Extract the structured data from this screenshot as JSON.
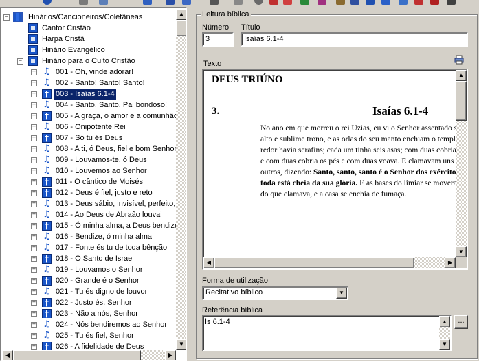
{
  "tree": {
    "root_label": "Hinários/Cancioneiros/Coletâneas",
    "books": [
      {
        "label": "Cantor Cristão"
      },
      {
        "label": "Harpa Cristã"
      },
      {
        "label": "Hinário Evangélico"
      },
      {
        "label": "Hinário para o Culto Cristão"
      }
    ],
    "items": [
      {
        "label": "001 - Oh, vinde adorar!",
        "icon": "music-note-icon",
        "selected": false
      },
      {
        "label": "002 - Santo! Santo! Santo!",
        "icon": "music-note-icon",
        "selected": false
      },
      {
        "label": "003 - Isaías 6.1-4",
        "icon": "bible-reading-icon",
        "selected": true
      },
      {
        "label": "004 - Santo, Santo, Pai bondoso!",
        "icon": "music-note-icon",
        "selected": false
      },
      {
        "label": "005 - A graça, o amor e a comunhão",
        "icon": "bible-reading-icon",
        "selected": false
      },
      {
        "label": "006 - Onipotente Rei",
        "icon": "music-note-icon",
        "selected": false
      },
      {
        "label": "007 - Só tu és Deus",
        "icon": "bible-reading-icon",
        "selected": false
      },
      {
        "label": "008 - A ti, ó Deus, fiel e bom Senhor",
        "icon": "music-note-icon",
        "selected": false
      },
      {
        "label": "009 - Louvamos-te, ó Deus",
        "icon": "music-note-icon",
        "selected": false
      },
      {
        "label": "010 - Louvemos ao Senhor",
        "icon": "music-note-icon",
        "selected": false
      },
      {
        "label": "011 - O cântico de Moisés",
        "icon": "bible-reading-icon",
        "selected": false
      },
      {
        "label": "012 - Deus é fiel, justo e reto",
        "icon": "bible-reading-icon",
        "selected": false
      },
      {
        "label": "013 - Deus sábio, invisível, perfeito, i",
        "icon": "music-note-icon",
        "selected": false
      },
      {
        "label": "014 - Ao Deus de Abraão louvai",
        "icon": "music-note-icon",
        "selected": false
      },
      {
        "label": "015 - Ó minha alma, a Deus bendize",
        "icon": "bible-reading-icon",
        "selected": false
      },
      {
        "label": "016 - Bendize, ó minha alma",
        "icon": "music-note-icon",
        "selected": false
      },
      {
        "label": "017 - Fonte és tu de toda bênção",
        "icon": "music-note-icon",
        "selected": false
      },
      {
        "label": "018 - O Santo de Israel",
        "icon": "bible-reading-icon",
        "selected": false
      },
      {
        "label": "019 - Louvamos o Senhor",
        "icon": "music-note-icon",
        "selected": false
      },
      {
        "label": "020 - Grande é o Senhor",
        "icon": "bible-reading-icon",
        "selected": false
      },
      {
        "label": "021 - Tu és digno de louvor",
        "icon": "music-note-icon",
        "selected": false
      },
      {
        "label": "022 - Justo és, Senhor",
        "icon": "bible-reading-icon",
        "selected": false
      },
      {
        "label": "023 - Não a nós, Senhor",
        "icon": "bible-reading-icon",
        "selected": false
      },
      {
        "label": "024 - Nós bendiremos ao Senhor",
        "icon": "music-note-icon",
        "selected": false
      },
      {
        "label": "025 - Tu és fiel, Senhor",
        "icon": "music-note-icon",
        "selected": false
      },
      {
        "label": "026 - A fidelidade de Deus",
        "icon": "bible-reading-icon",
        "selected": false
      }
    ]
  },
  "form": {
    "group_title": "Leitura bíblica",
    "numero_label": "Número",
    "numero_value": "3",
    "titulo_label": "Título",
    "titulo_value": "Isaías 6.1-4",
    "texto_label": "Texto",
    "forma_label": "Forma de utilização",
    "forma_value": "Recitativo bíblico",
    "referencia_label": "Referência bíblica",
    "referencia_value": "Is 6.1-4",
    "ellipsis_label": "..."
  },
  "document": {
    "heading": "DEUS TRIÚNO",
    "number": "3.",
    "reference": "Isaías 6.1-4",
    "body_plain_1": "No ano em que morreu o rei Uzias, eu vi o Senhor assentado sobre um alto e sublime trono, e as orlas do seu manto enchiam o templo. Ao seu redor havia serafins; cada um tinha seis asas; com duas cobria o rosto, e com duas cobria os pés e com duas voava. E clamavam uns para os outros, dizendo: ",
    "body_bold": "Santo, santo, santo é o Senhor dos exércitos; a terra toda está cheia da sua glória.",
    "body_plain_2": " E as bases do limiar se moveram à voz do que clamava, e a casa se enchia de fumaça."
  }
}
